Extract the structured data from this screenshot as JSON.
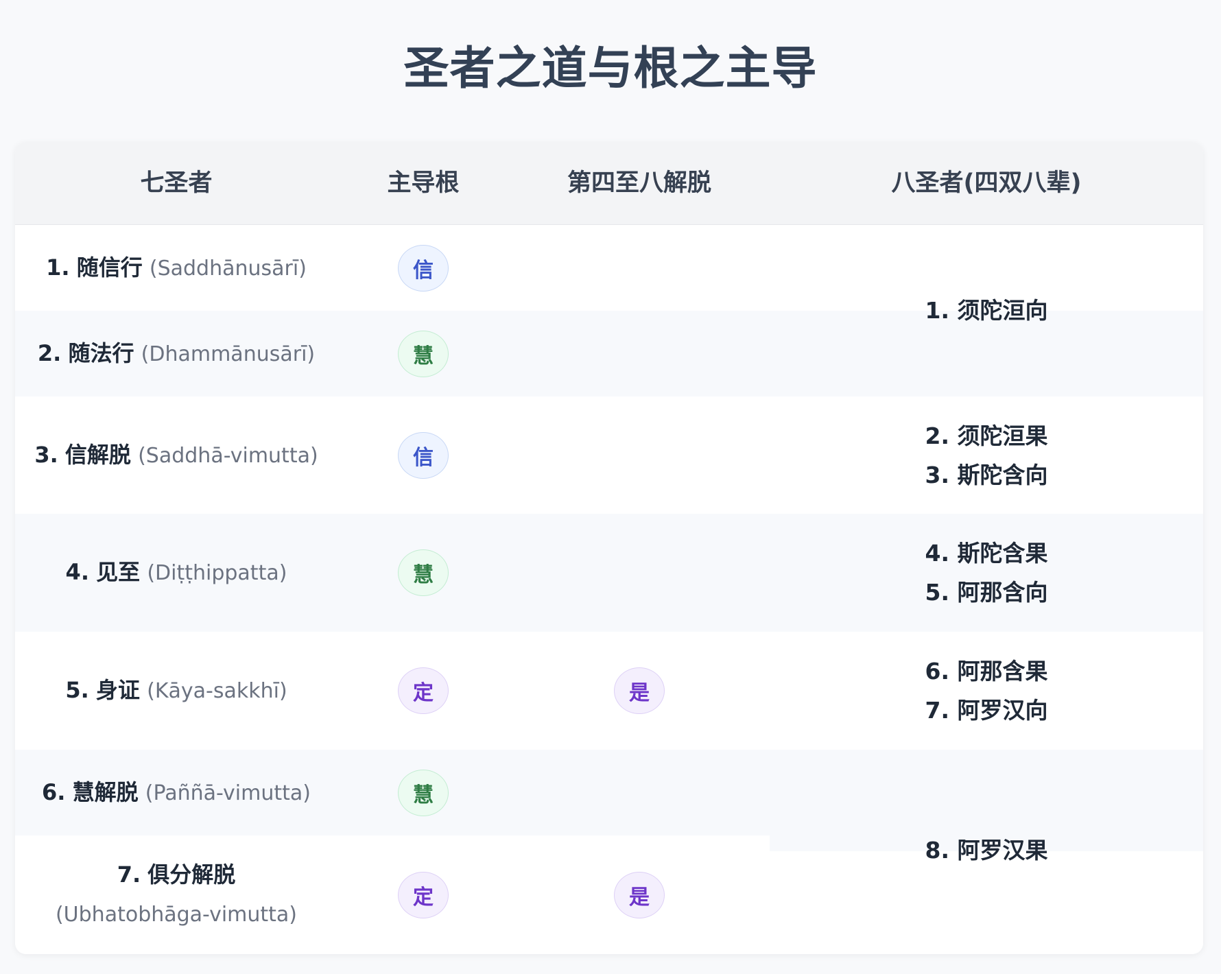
{
  "title": "圣者之道与根之主导",
  "columns": [
    "七圣者",
    "主导根",
    "第四至八解脱",
    "八圣者(四双八辈)"
  ],
  "rows": [
    {
      "num": "1.",
      "name": "随信行",
      "pali": "(Saddhānusārī)",
      "root": "信",
      "root_kind": "xin",
      "liberation": ""
    },
    {
      "num": "2.",
      "name": "随法行",
      "pali": "(Dhammānusārī)",
      "root": "慧",
      "root_kind": "hui",
      "liberation": ""
    },
    {
      "num": "3.",
      "name": "信解脱",
      "pali": "(Saddhā-vimutta)",
      "root": "信",
      "root_kind": "xin",
      "liberation": ""
    },
    {
      "num": "4.",
      "name": "见至",
      "pali": "(Diṭṭhippatta)",
      "root": "慧",
      "root_kind": "hui",
      "liberation": ""
    },
    {
      "num": "5.",
      "name": "身证",
      "pali": "(Kāya-sakkhī)",
      "root": "定",
      "root_kind": "ding",
      "liberation": "是"
    },
    {
      "num": "6.",
      "name": "慧解脱",
      "pali": "(Paññā-vimutta)",
      "root": "慧",
      "root_kind": "hui",
      "liberation": ""
    },
    {
      "num": "7.",
      "name": "俱分解脱",
      "pali": "(Ubhatobhāga-vimutta)",
      "root": "定",
      "root_kind": "ding",
      "liberation": "是"
    }
  ],
  "eight_noble": {
    "g1": [
      "1. 须陀洹向"
    ],
    "g2": [
      "2. 须陀洹果",
      "3. 斯陀含向"
    ],
    "g3": [
      "4. 斯陀含果",
      "5. 阿那含向"
    ],
    "g4": [
      "6. 阿那含果",
      "7. 阿罗汉向"
    ],
    "g5": [
      "8. 阿罗汉果"
    ]
  },
  "colors": {
    "xin": "#3b56c9",
    "hui": "#2f7d45",
    "ding": "#6d35c9",
    "title": "#334155"
  }
}
